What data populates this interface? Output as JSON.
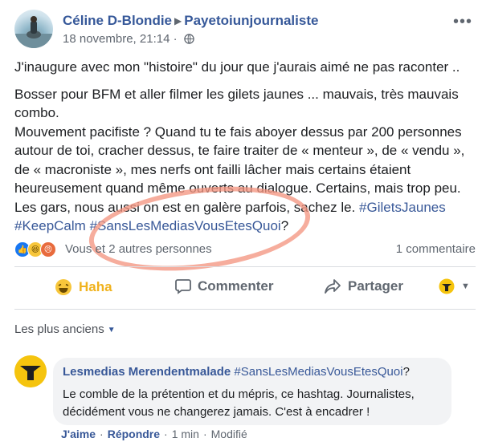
{
  "post": {
    "author": "Céline D-Blondie",
    "group": "Payetoiunjournaliste",
    "timestamp": "18 novembre, 21:14",
    "dot": "·",
    "paragraph1": "J'inaugure avec mon \"histoire\" du jour que j'aurais aimé ne pas raconter ..",
    "paragraph2_text": "Bosser pour BFM et aller filmer les gilets jaunes ... mauvais, très mauvais combo.\nMouvement pacifiste ? Quand tu te fais aboyer dessus par 200 personnes autour de toi, cracher dessus, te faire traiter de « menteur », de « vendu », de « macroniste », mes nerfs ont failli lâcher mais certains étaient heureusement quand même ouverts au dialogue. Certains, mais trop peu. Les gars, nous aussi on est en galère parfois, sachez le. ",
    "hashtag1": "#GiletsJaunes",
    "hashtag2": "#KeepCalm",
    "hashtag3": "#SansLesMediasVousEtesQuoi",
    "question_mark": "?"
  },
  "reactions": {
    "reactors": "Vous et 2 autres personnes",
    "comments_count": "1 commentaire"
  },
  "actions": {
    "haha": "Haha",
    "comment": "Commenter",
    "share": "Partager"
  },
  "comments_sort": "Les plus anciens",
  "comment": {
    "author": "Lesmedias Merendentmalade",
    "hashtag": "#SansLesMediasVousEtesQuoi",
    "question_mark": "?",
    "text": "Le comble de la prétention et du mépris, ce hashtag. Journalistes, décidément vous ne changerez jamais. C'est à encadrer !",
    "like": "J'aime",
    "reply": "Répondre",
    "time": "1 min",
    "edited": "Modifié",
    "dot": "·"
  },
  "colors": {
    "link_blue": "#365899",
    "haha_yellow": "#f0b21d",
    "annotation": "#f49682"
  }
}
